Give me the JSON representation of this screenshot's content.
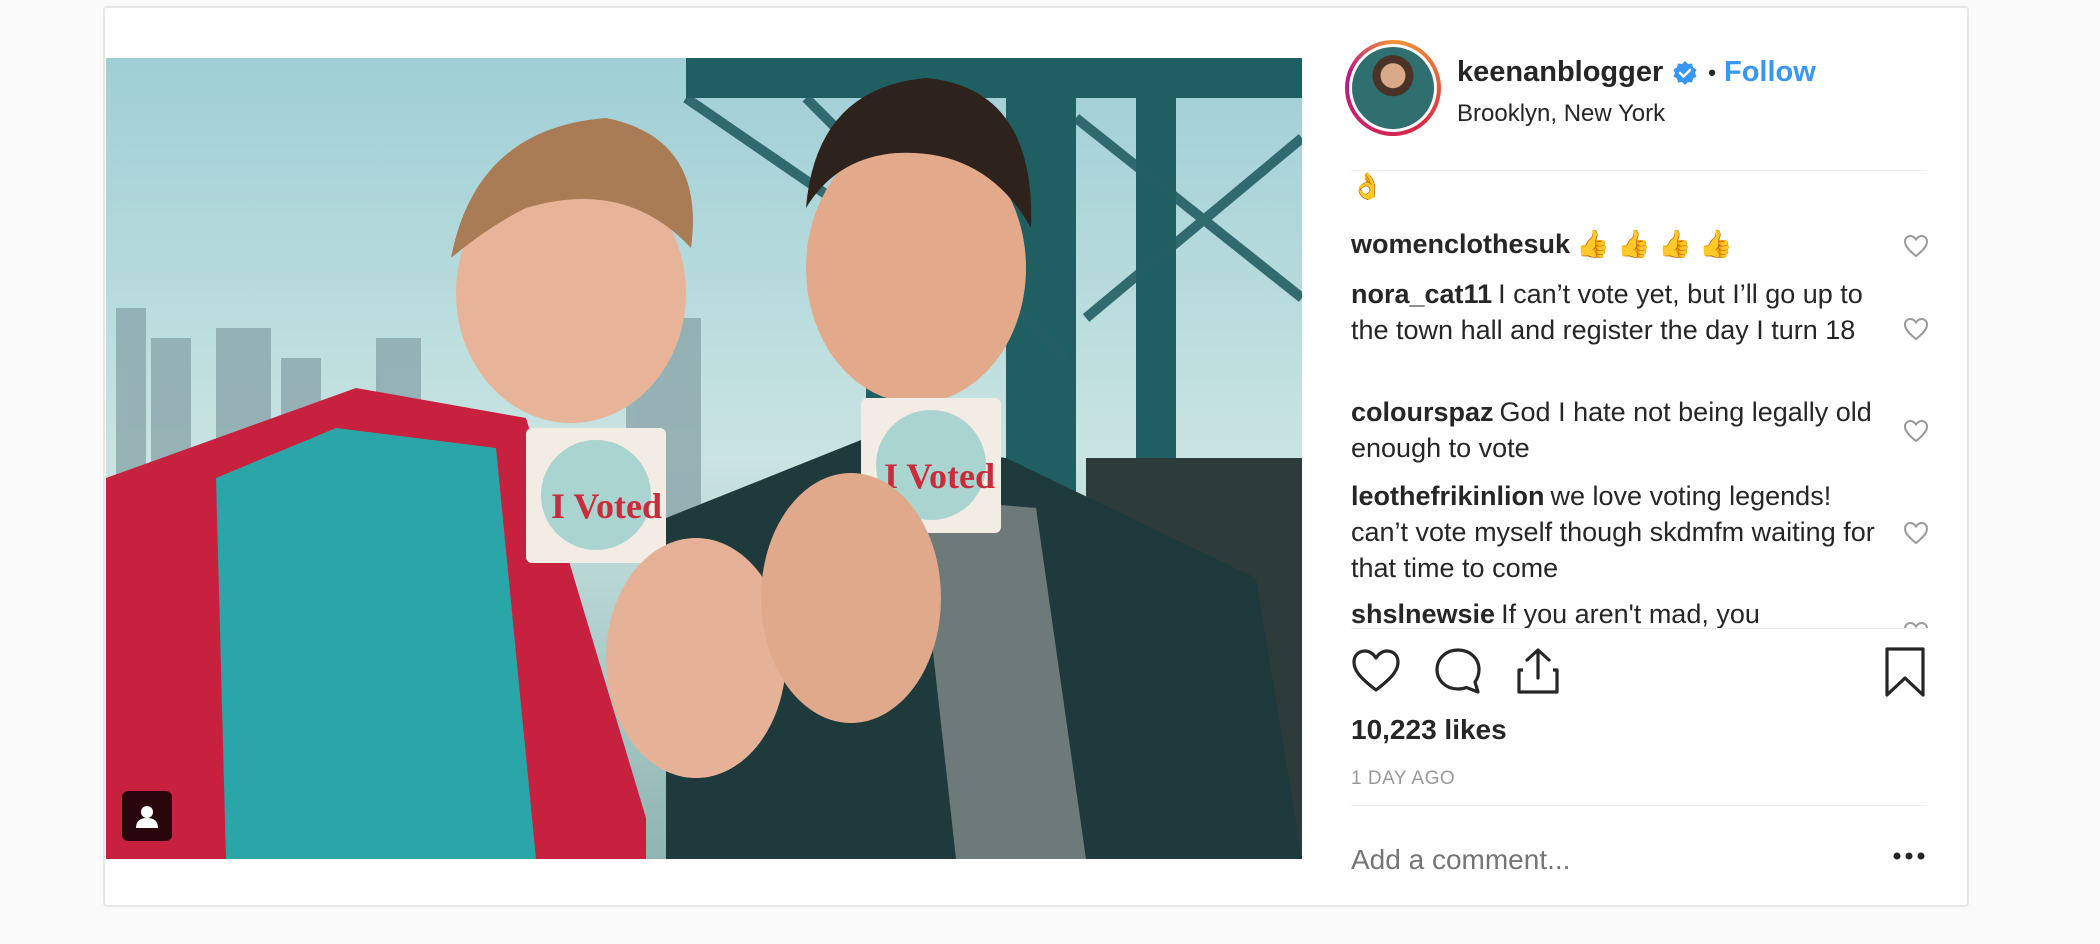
{
  "post": {
    "author": "keenanblogger",
    "separator": "•",
    "follow_label": "Follow",
    "location": "Brooklyn, New York",
    "partial_caption_emoji": "👌",
    "comments": [
      {
        "author": "womenclothesuk",
        "text": "👍 👍 👍 👍"
      },
      {
        "author": "nora_cat11",
        "text": "I can’t vote yet, but I’ll go up to the town hall and register the day I turn 18"
      },
      {
        "author": "colourspaz",
        "text": "God I hate not being legally old enough to vote"
      },
      {
        "author": "leothefrikinlion",
        "text": "we love voting legends! can’t vote myself though skdmfm waiting for that time to come"
      },
      {
        "author": "shslnewsie",
        "text": "If you aren't mad, you"
      }
    ],
    "likes": "10,223 likes",
    "time_ago": "1 DAY AGO",
    "comment_placeholder": "Add a comment..."
  },
  "icons": {
    "verified": "verified-badge-icon",
    "like": "heart-icon",
    "comment": "comment-icon",
    "share": "share-icon",
    "save": "bookmark-icon",
    "more": "more-options-icon",
    "user_tag": "person-icon"
  },
  "colors": {
    "accent": "#3897f0",
    "text": "#262626",
    "muted": "#999999",
    "border": "#efefef"
  }
}
